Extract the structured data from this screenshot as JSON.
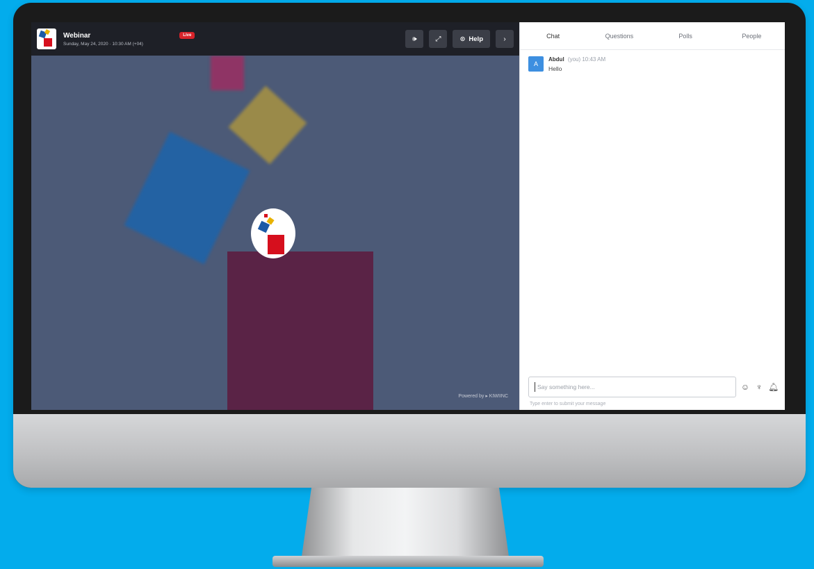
{
  "webinar": {
    "title": "Webinar",
    "live_badge": "Live",
    "subtitle": "Sunday, May 24, 2020 · 10:30 AM (+04)"
  },
  "toolbar": {
    "help_label": "Help"
  },
  "video": {
    "powered_by": "Powered by  ▸ KIWIINC"
  },
  "tabs": [
    {
      "label": "Chat",
      "active": true
    },
    {
      "label": "Questions"
    },
    {
      "label": "Polls"
    },
    {
      "label": "People"
    }
  ],
  "messages": [
    {
      "avatar": "A",
      "name": "Abdul",
      "meta": "(you)  10:43 AM",
      "text": "Hello"
    }
  ],
  "composer": {
    "placeholder": "Say something here...",
    "hint": "Type enter to submit your message"
  },
  "icons": {
    "emoji": "emoji-icon",
    "gif": "gif-icon",
    "notification": "bell-icon"
  },
  "colors": {
    "background": "#03acec",
    "video_bg": "#4c5a77",
    "live_red": "#d8232a",
    "avatar_blue": "#3d8fe0"
  }
}
